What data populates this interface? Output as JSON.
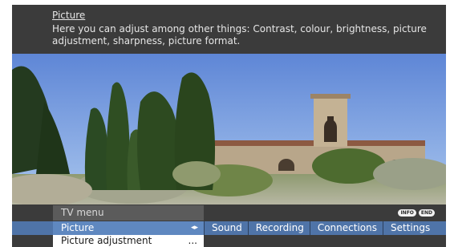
{
  "help": {
    "title": "Picture",
    "body": "Here you can adjust among other things: Contrast, colour, brightness, picture adjustment, sharpness, picture format."
  },
  "keys": {
    "info": "INFO",
    "end": "END"
  },
  "menu": {
    "title": "TV menu",
    "selected": "Picture",
    "selected_arrows": "◂▸",
    "tabs": [
      "Sound",
      "Recording",
      "Connections",
      "Settings"
    ],
    "sub_item": "Picture adjustment",
    "sub_item_more": "..."
  },
  "colors": {
    "menu_bar": "#3b3b3b",
    "selected_row": "#4f74a8",
    "selected_item": "#5f88c0"
  }
}
